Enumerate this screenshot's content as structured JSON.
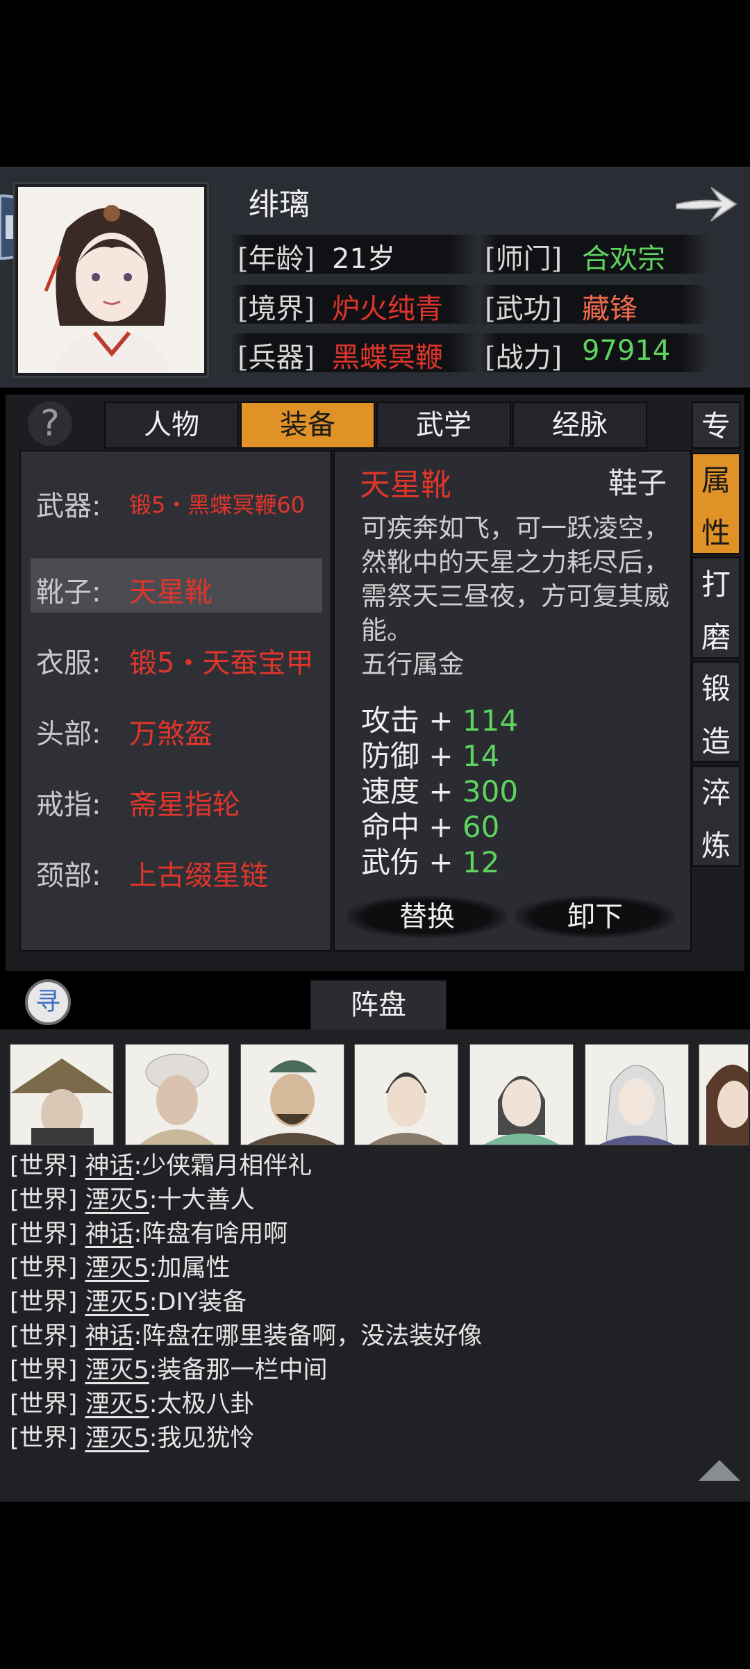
{
  "character": {
    "name": "绯璃",
    "fields": [
      {
        "label": "[年龄]",
        "value": "21岁",
        "color": "#e6e6e6"
      },
      {
        "label": "[师门]",
        "value": "合欢宗",
        "color": "#5fd35f"
      },
      {
        "label": "[境界]",
        "value": "炉火纯青",
        "color": "#e0352b"
      },
      {
        "label": "[武功]",
        "value": "藏锋",
        "color": "#f06a4e"
      },
      {
        "label": "[兵器]",
        "value": "黑蝶冥鞭",
        "color": "#e0352b"
      },
      {
        "label": "[战力]",
        "value": "97914",
        "color": "#5fd35f"
      }
    ]
  },
  "tabs": [
    "人物",
    "装备",
    "武学",
    "经脉"
  ],
  "active_tab": "装备",
  "side_tabs": [
    {
      "label": "专",
      "active": false
    },
    {
      "label": "属\n性",
      "active": true
    },
    {
      "label": "打\n磨",
      "active": false
    },
    {
      "label": "锻\n造",
      "active": false
    },
    {
      "label": "淬\n炼",
      "active": false
    }
  ],
  "equipment": [
    {
      "slot": "武器:",
      "item": "锻5・黑蝶冥鞭60"
    },
    {
      "slot": "靴子:",
      "item": "天星靴"
    },
    {
      "slot": "衣服:",
      "item": "锻5・天蚕宝甲"
    },
    {
      "slot": "头部:",
      "item": "万煞盔"
    },
    {
      "slot": "戒指:",
      "item": "斋星指轮"
    },
    {
      "slot": "颈部:",
      "item": "上古缀星链"
    }
  ],
  "selected_item": {
    "name": "天星靴",
    "type": "鞋子",
    "description": "可疾奔如飞，可一跃凌空，然靴中的天星之力耗尽后，需祭天三昼夜，方可复其威能。",
    "element": "五行属金",
    "stats": [
      {
        "name": "攻击",
        "value": "114"
      },
      {
        "name": "防御",
        "value": "14"
      },
      {
        "name": "速度",
        "value": "300"
      },
      {
        "name": "命中",
        "value": "60"
      },
      {
        "name": "武伤",
        "value": "12"
      }
    ]
  },
  "buttons": {
    "replace": "替换",
    "unequip": "卸下"
  },
  "formation": {
    "search_icon_label": "寻",
    "label": "阵盘"
  },
  "chat": [
    {
      "channel": "[世界]",
      "user": "神话",
      "msg": ":少侠霜月相伴礼"
    },
    {
      "channel": "[世界]",
      "user": "湮灭5",
      "msg": ":十大善人"
    },
    {
      "channel": "[世界]",
      "user": "神话",
      "msg": ":阵盘有啥用啊"
    },
    {
      "channel": "[世界]",
      "user": "湮灭5",
      "msg": ":加属性"
    },
    {
      "channel": "[世界]",
      "user": "湮灭5",
      "msg": ":DIY装备"
    },
    {
      "channel": "[世界]",
      "user": "神话",
      "msg": ":阵盘在哪里装备啊，没法装好像"
    },
    {
      "channel": "[世界]",
      "user": "湮灭5",
      "msg": ":装备那一栏中间"
    },
    {
      "channel": "[世界]",
      "user": "湮灭5",
      "msg": ":太极八卦"
    },
    {
      "channel": "[世界]",
      "user": "湮灭5",
      "msg": ":我见犹怜"
    }
  ],
  "colors": {
    "accent": "#e09226",
    "red": "#e0352b",
    "green": "#5fd35f"
  },
  "icons": [
    "lock-icon",
    "next-arrow-icon",
    "help-icon",
    "search-icon",
    "scroll-up-icon"
  ]
}
